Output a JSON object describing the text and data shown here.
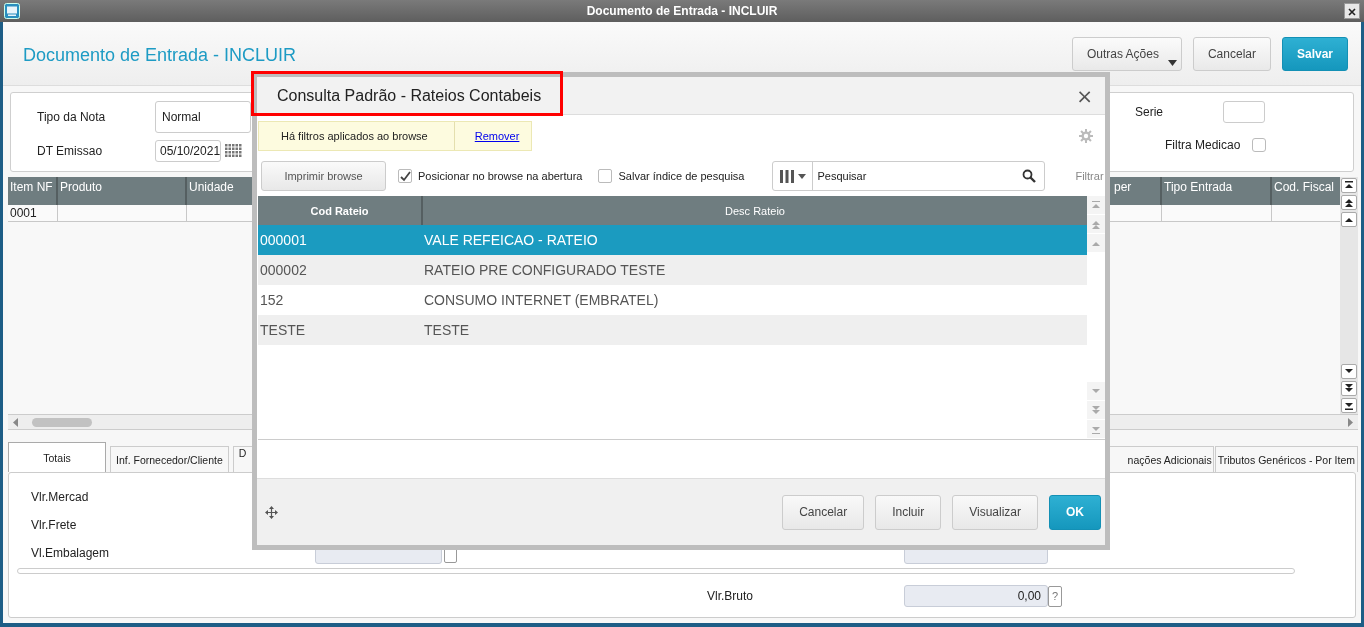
{
  "window": {
    "title": "Documento de Entrada - INCLUIR"
  },
  "header": {
    "title": "Documento de Entrada - INCLUIR",
    "buttons": [
      {
        "label": "Outras Ações",
        "kind": "menu"
      },
      {
        "label": "Cancelar",
        "kind": "default"
      },
      {
        "label": "Salvar",
        "kind": "primary"
      }
    ]
  },
  "form": {
    "tipo_nota": {
      "label": "Tipo da Nota",
      "value": "Normal"
    },
    "dt_emissao": {
      "label": "DT Emissao",
      "value": "05/10/2021"
    },
    "serie": {
      "label": "Serie"
    },
    "filtra_medicao": {
      "label": "Filtra Medicao",
      "checked": false
    }
  },
  "grid": {
    "columns": [
      "Item NF",
      "Produto",
      "Unidade",
      "per",
      "Tipo Entrada",
      "Cod. Fiscal"
    ],
    "rows": [
      [
        "0001"
      ]
    ]
  },
  "tabs": [
    {
      "label": "Totais",
      "selected": true
    },
    {
      "label": "Inf. Fornecedor/Cliente",
      "selected": false
    },
    {
      "label": "D",
      "selected": false
    },
    {
      "label": "nações Adicionais",
      "selected": false
    },
    {
      "label": "Tributos Genéricos - Por Item",
      "selected": false
    }
  ],
  "totals": {
    "rows": [
      {
        "label": "Vlr.Mercad"
      },
      {
        "label": "Vlr.Frete"
      },
      {
        "label": "Vl.Embalagem"
      },
      {
        "right_label": "Vlr.Bruto",
        "right_value": "0,00"
      }
    ],
    "help": "?"
  },
  "dialog": {
    "title": "Consulta Padrão - Rateios Contabeis",
    "close": "×",
    "filter_notice": {
      "text": "Há filtros aplicados ao browse",
      "link": "Remover"
    },
    "print_button": "Imprimir browse",
    "options": [
      {
        "label": "Posicionar no browse na abertura",
        "checked": true
      },
      {
        "label": "Salvar índice de pesquisa",
        "checked": false
      }
    ],
    "search": {
      "placeholder": "Pesquisar"
    },
    "filter_link": "Filtrar",
    "table": {
      "columns": [
        "Cod Rateio",
        "Desc Rateio"
      ],
      "rows": [
        {
          "cells": [
            "000001",
            "VALE REFEICAO - RATEIO"
          ],
          "selected": true
        },
        {
          "cells": [
            "000002",
            "RATEIO PRE CONFIGURADO TESTE"
          ],
          "selected": false
        },
        {
          "cells": [
            "152",
            "CONSUMO INTERNET (EMBRATEL)"
          ],
          "selected": false
        },
        {
          "cells": [
            "TESTE",
            "TESTE"
          ],
          "selected": false
        }
      ]
    },
    "buttons": [
      {
        "label": "Cancelar",
        "kind": "default"
      },
      {
        "label": "Incluir",
        "kind": "default"
      },
      {
        "label": "Visualizar",
        "kind": "default"
      },
      {
        "label": "OK",
        "kind": "primary"
      }
    ]
  }
}
